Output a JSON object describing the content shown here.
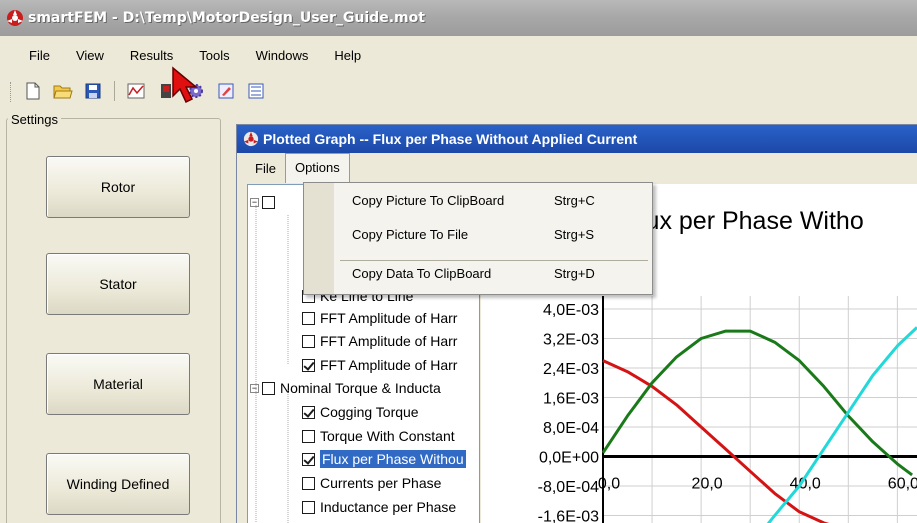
{
  "window": {
    "title": "smartFEM  -  D:\\Temp\\MotorDesign_User_Guide.mot"
  },
  "menubar": [
    "File",
    "View",
    "Results",
    "Tools",
    "Windows",
    "Help"
  ],
  "toolbar": [
    "new-icon",
    "open-icon",
    "save-icon",
    "graph-icon",
    "magnet-icon",
    "gear-icon",
    "edit-icon",
    "list-icon"
  ],
  "settings": {
    "label": "Settings",
    "buttons": [
      "Rotor",
      "Stator",
      "Material",
      "Winding Defined"
    ]
  },
  "graph_window": {
    "title": "Plotted Graph -- Flux per Phase Without Applied Current",
    "menu": [
      "File",
      "Options"
    ],
    "options_menu": {
      "items": [
        {
          "label": "Copy Picture To ClipBoard",
          "shortcut": "Strg+C"
        },
        {
          "label": "Copy Picture To File",
          "shortcut": "Strg+S"
        },
        {
          "label": "Copy Data To ClipBoard",
          "shortcut": "Strg+D"
        }
      ]
    }
  },
  "tree": {
    "rows": [
      {
        "label": "Ke Line to Line",
        "checked": false
      },
      {
        "label": "FFT Amplitude of Harr",
        "checked": false
      },
      {
        "label": "FFT Amplitude of Harr",
        "checked": false
      },
      {
        "label": "FFT Amplitude of Harr",
        "checked": true
      },
      {
        "label": "Nominal Torque & Inducta",
        "checked": false
      },
      {
        "label": "Cogging Torque",
        "checked": true
      },
      {
        "label": "Torque With Constant",
        "checked": false
      },
      {
        "label": "Flux per Phase Withou",
        "checked": true,
        "selected": true
      },
      {
        "label": "Currents per Phase",
        "checked": false
      },
      {
        "label": "Inductance per Phase",
        "checked": false
      }
    ]
  },
  "chart_data": {
    "type": "line",
    "title": "lux per Phase Witho",
    "y_ticks": [
      "4,0E-03",
      "3,2E-03",
      "2,4E-03",
      "1,6E-03",
      "8,0E-04",
      "0,0E+00",
      "-8,0E-04",
      "-1,6E-03"
    ],
    "x_ticks": [
      "0,0",
      "20,0",
      "40,0",
      "60,0"
    ],
    "xlim": [
      0,
      64
    ],
    "ylim": [
      -0.0016,
      0.004
    ],
    "grid": true,
    "colors": {
      "red": "#d41414",
      "green": "#1a7a1a",
      "cyan": "#22d8d8"
    },
    "series": [
      {
        "color": "red",
        "x": [
          0,
          5,
          10,
          15,
          20,
          25,
          30,
          35,
          40,
          45,
          50,
          55
        ],
        "y": [
          0.0026,
          0.0023,
          0.0019,
          0.0014,
          0.0008,
          0.0002,
          -0.0004,
          -0.001,
          -0.0015,
          -0.0018,
          -0.002,
          -0.0021
        ]
      },
      {
        "color": "green",
        "x": [
          0,
          5,
          10,
          15,
          20,
          25,
          30,
          35,
          40,
          45,
          50,
          55,
          60,
          63
        ],
        "y": [
          0.0001,
          0.0011,
          0.002,
          0.0027,
          0.0032,
          0.0034,
          0.0034,
          0.0031,
          0.0026,
          0.0019,
          0.0011,
          0.0004,
          -0.0002,
          -0.0005
        ]
      },
      {
        "color": "cyan",
        "x": [
          32,
          35,
          40,
          45,
          50,
          55,
          60,
          64
        ],
        "y": [
          -0.0021,
          -0.0016,
          -0.0008,
          0.0002,
          0.0012,
          0.0022,
          0.003,
          0.0035
        ]
      }
    ]
  }
}
